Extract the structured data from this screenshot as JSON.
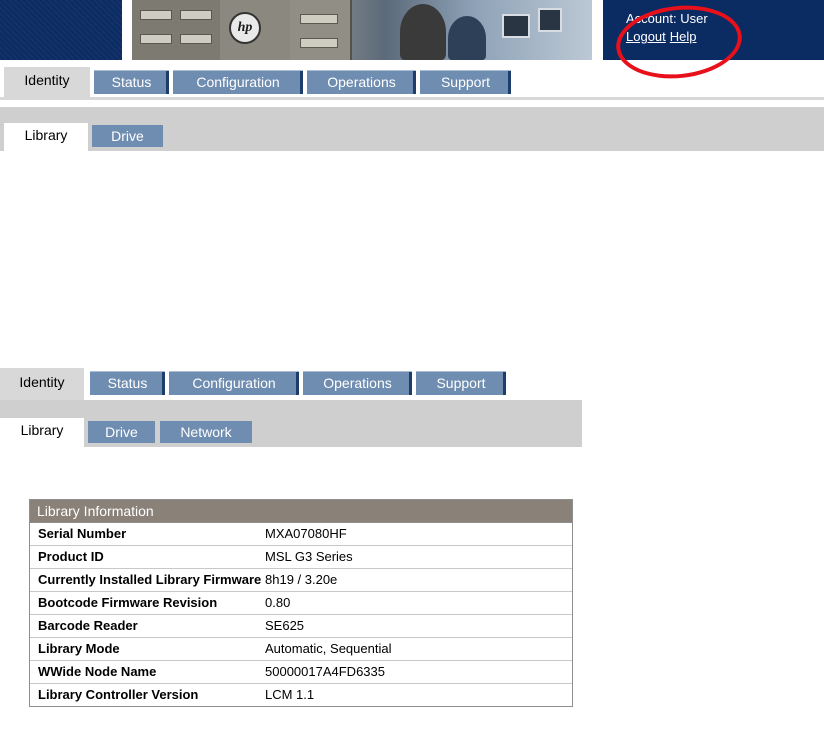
{
  "header": {
    "account_label": "Account: User",
    "logout_label": "Logout",
    "help_label": "Help",
    "brand_logo": "hp"
  },
  "tabs_top": {
    "main": [
      "Identity",
      "Status",
      "Configuration",
      "Operations",
      "Support"
    ],
    "sub": [
      "Library",
      "Drive"
    ]
  },
  "tabs_bottom": {
    "main": [
      "Identity",
      "Status",
      "Configuration",
      "Operations",
      "Support"
    ],
    "sub": [
      "Library",
      "Drive",
      "Network"
    ]
  },
  "library_info": {
    "title": "Library Information",
    "rows": [
      {
        "label": "Serial Number",
        "value": "MXA07080HF"
      },
      {
        "label": "Product ID",
        "value": "MSL G3 Series"
      },
      {
        "label": "Currently Installed Library Firmware",
        "value": "8h19 / 3.20e"
      },
      {
        "label": "Bootcode Firmware Revision",
        "value": "0.80"
      },
      {
        "label": "Barcode Reader",
        "value": "SE625"
      },
      {
        "label": "Library Mode",
        "value": "Automatic, Sequential"
      },
      {
        "label": "WWide Node Name",
        "value": "50000017A4FD6335"
      },
      {
        "label": "Library Controller Version",
        "value": "LCM 1.1"
      }
    ]
  },
  "colors": {
    "header_blue": "#0b2b63",
    "tab_blue": "#6f8db0",
    "table_title": "#8a8178",
    "annotation_red": "#e8101a"
  }
}
